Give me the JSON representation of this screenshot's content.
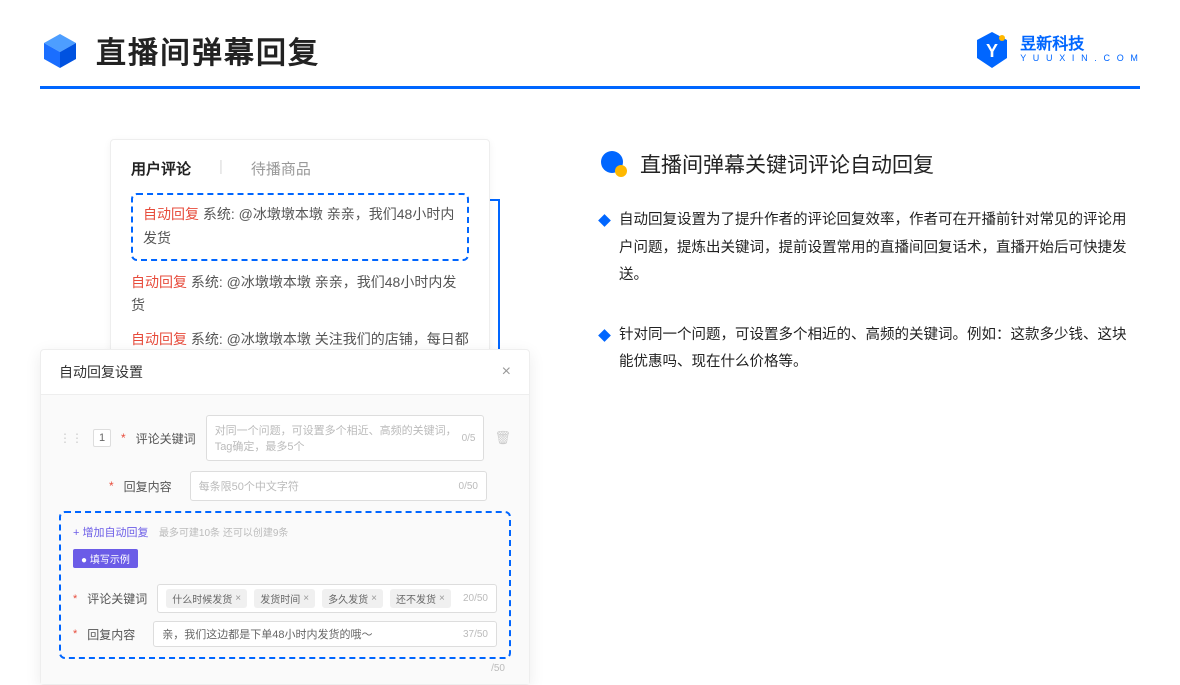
{
  "header": {
    "title": "直播间弹幕回复",
    "logo_cn": "昱新科技",
    "logo_en": "Y U U X I N . C O M"
  },
  "card1": {
    "tab_active": "用户评论",
    "tab_inactive": "待播商品",
    "c1_tag": "自动回复",
    "c1_text": " 系统: @冰墩墩本墩 亲亲，我们48小时内发货",
    "c2_tag": "自动回复",
    "c2_text": " 系统: @冰墩墩本墩 亲亲，我们48小时内发货",
    "c3_tag": "自动回复",
    "c3_text": " 系统: @冰墩墩本墩 关注我们的店铺，每日都有热门推荐呦～"
  },
  "card2": {
    "title": "自动回复设置",
    "idx": "1",
    "label_keyword": "评论关键词",
    "placeholder_keyword": "对同一个问题，可设置多个相近、高频的关键词，Tag确定，最多5个",
    "counter_keyword": "0/5",
    "label_content": "回复内容",
    "placeholder_content": "每条限50个中文字符",
    "counter_content": "0/50",
    "add_link": "+ 增加自动回复",
    "add_hint": "最多可建10条 还可以创建9条",
    "badge": "● 填写示例",
    "ex_label_kw": "评论关键词",
    "ex_tags": [
      "什么时候发货",
      "发货时间",
      "多久发货",
      "还不发货"
    ],
    "ex_kw_counter": "20/50",
    "ex_label_ct": "回复内容",
    "ex_content": "亲，我们这边都是下单48小时内发货的哦～",
    "ex_ct_counter": "37/50",
    "outer_counter": "/50"
  },
  "right": {
    "section_title": "直播间弹幕关键词评论自动回复",
    "p1": "自动回复设置为了提升作者的评论回复效率，作者可在开播前针对常见的评论用户问题，提炼出关键词，提前设置常用的直播间回复话术，直播开始后可快捷发送。",
    "p2": "针对同一个问题，可设置多个相近的、高频的关键词。例如：这款多少钱、这块能优惠吗、现在什么价格等。"
  }
}
